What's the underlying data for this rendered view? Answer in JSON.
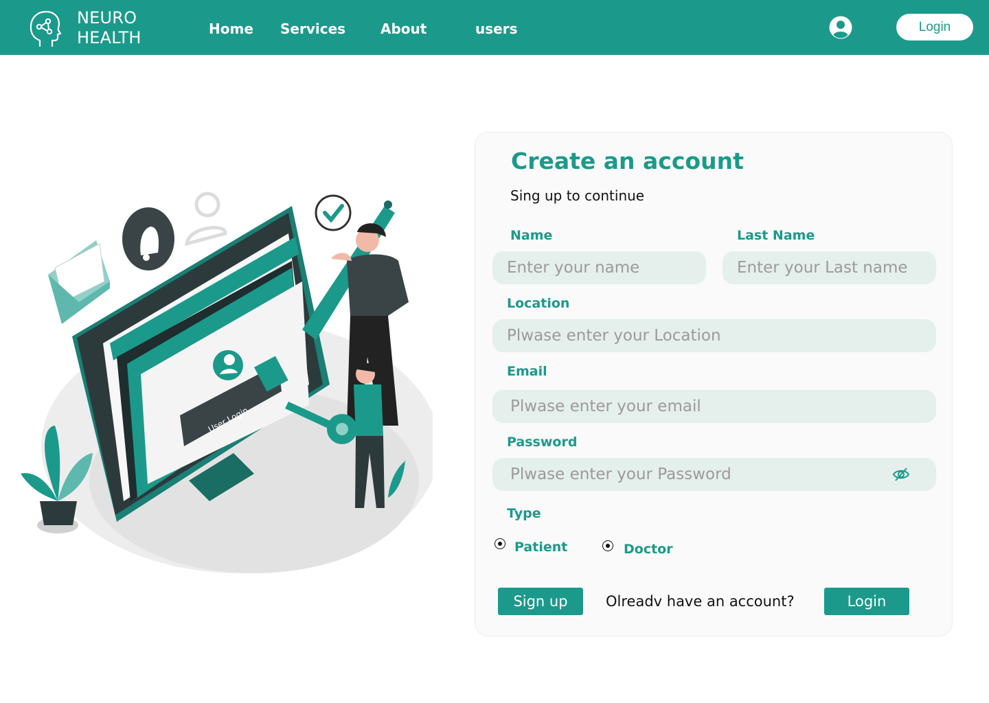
{
  "brand": {
    "line1": "NEURO",
    "line2": "HEALTH"
  },
  "nav": {
    "home": "Home",
    "services": "Services",
    "about": "About",
    "users": "users"
  },
  "header": {
    "login_label": "Login"
  },
  "illustration": {
    "screen_label": "User Login"
  },
  "form": {
    "title": "Create an account",
    "subtitle": "Sing up to continue",
    "name_label": "Name",
    "name_placeholder": "Enter your name",
    "lastname_label": "Last Name",
    "lastname_placeholder": "Enter your Last name",
    "location_label": "Location",
    "location_placeholder": "Plwase enter your Location",
    "email_label": "Email",
    "email_placeholder": "Plwase enter your email",
    "password_label": "Password",
    "password_placeholder": "Plwase enter your Password",
    "type_label": "Type",
    "type_options": [
      "Patient",
      "Doctor"
    ],
    "signup_label": "Sign up",
    "already_text": "Olreadv have an account?",
    "login_label": "Login"
  },
  "colors": {
    "brand": "#1b9a8b",
    "field_bg": "#e5efec"
  },
  "icons": [
    "brain-head-icon",
    "user-circle-icon",
    "eye-off-icon"
  ]
}
